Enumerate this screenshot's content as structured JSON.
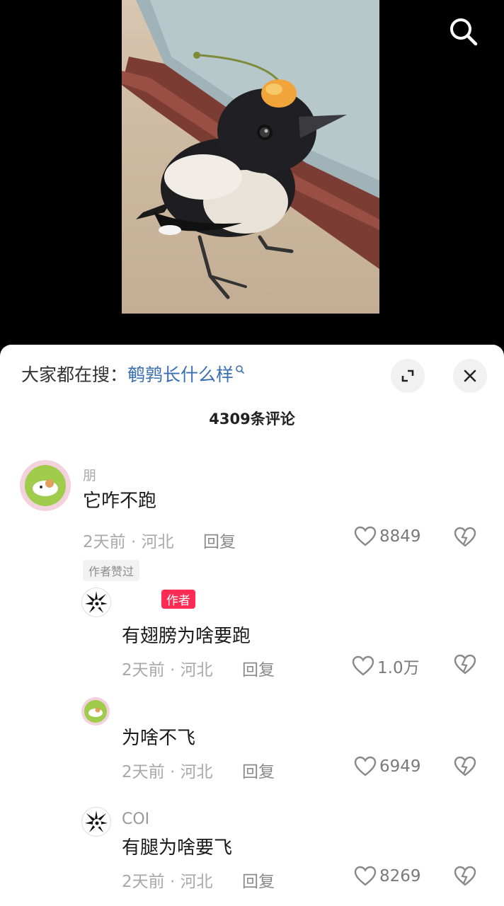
{
  "search": {
    "icon": "search-icon"
  },
  "sheet": {
    "suggest_prefix": "大家都在搜：",
    "suggest_link": "鹌鹑长什么样",
    "comment_count": "4309条评论",
    "expand_icon": "expand-icon",
    "close_icon": "close-icon"
  },
  "comments": [
    {
      "username": "朋",
      "text": "它咋不跑",
      "meta": "2天前 · 河北",
      "reply": "回复",
      "likes": "8849",
      "badge": "作者赞过"
    }
  ],
  "replies": [
    {
      "username": "",
      "author_badge": "作者",
      "text": "有翅膀为啥要跑",
      "meta": "2天前 · 河北",
      "reply": "回复",
      "likes": "1.0万"
    },
    {
      "username": "",
      "text": "为啥不飞",
      "meta": "2天前 · 河北",
      "reply": "回复",
      "likes": "6949"
    },
    {
      "username": "COI",
      "text": "有腿为啥要飞",
      "meta": "2天前 · 河北",
      "reply": "回复",
      "likes": "8269"
    }
  ],
  "colors": {
    "link": "#3a6fb0",
    "author_badge": "#fe2c55"
  }
}
